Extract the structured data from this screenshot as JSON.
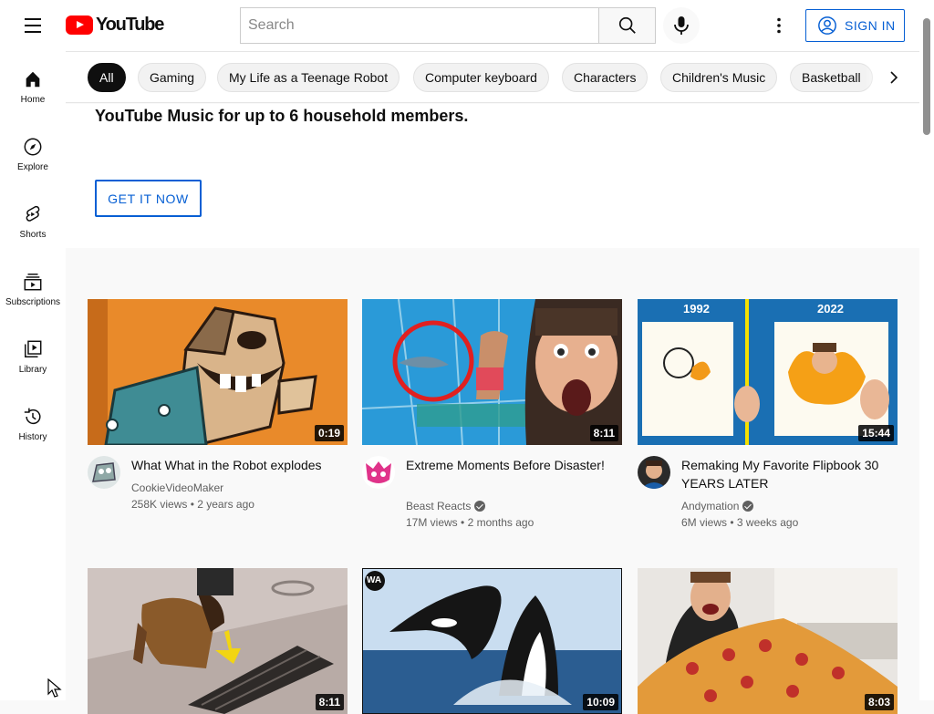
{
  "header": {
    "logo_text": "YouTube",
    "search_placeholder": "Search",
    "signin_label": "SIGN IN"
  },
  "sidebar": {
    "items": [
      {
        "label": "Home",
        "icon": "home-icon"
      },
      {
        "label": "Explore",
        "icon": "compass-icon"
      },
      {
        "label": "Shorts",
        "icon": "shorts-icon"
      },
      {
        "label": "Subscriptions",
        "icon": "subscriptions-icon"
      },
      {
        "label": "Library",
        "icon": "library-icon"
      },
      {
        "label": "History",
        "icon": "history-icon"
      }
    ]
  },
  "chips": [
    "All",
    "Gaming",
    "My Life as a Teenage Robot",
    "Computer keyboard",
    "Characters",
    "Children's Music",
    "Basketball"
  ],
  "promo": {
    "title": "YouTube Music for up to 6 household members.",
    "button": "GET IT NOW"
  },
  "videos": [
    {
      "title": "What What in the Robot explodes",
      "channel": "CookieVideoMaker",
      "verified": false,
      "views": "258K views",
      "age": "2 years ago",
      "duration": "0:19"
    },
    {
      "title": "Extreme Moments Before Disaster!",
      "channel": "Beast Reacts",
      "verified": true,
      "views": "17M views",
      "age": "2 months ago",
      "duration": "8:11"
    },
    {
      "title": "Remaking My Favorite Flipbook 30 YEARS LATER",
      "channel": "Andymation",
      "verified": true,
      "views": "6M views",
      "age": "3 weeks ago",
      "duration": "15:44",
      "thumb_labels": [
        "1992",
        "2022"
      ]
    },
    {
      "duration": "8:11"
    },
    {
      "duration": "10:09",
      "thumb_badge": "WA"
    },
    {
      "duration": "8:03"
    }
  ],
  "colors": {
    "brand_red": "#ff0000",
    "link_blue": "#065fd4",
    "chip_active": "#0f0f0f"
  }
}
